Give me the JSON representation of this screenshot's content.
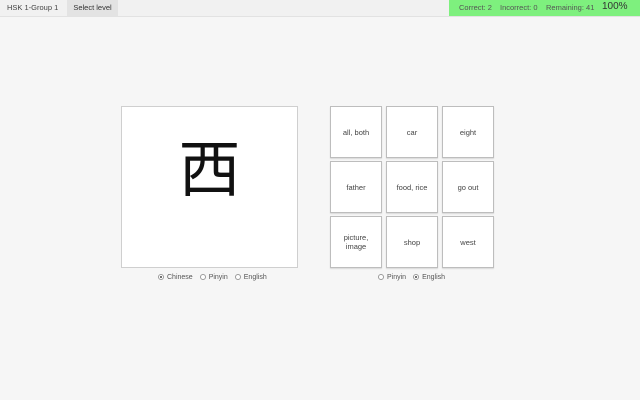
{
  "header": {
    "level_title": "HSK 1-Group 1",
    "select_level_label": "Select level",
    "correct": "Correct: 2",
    "incorrect": "Incorrect: 0",
    "remaining": "Remaining: 41",
    "percent": "100%",
    "stats_color": "#7ef07e"
  },
  "card": {
    "character": "西"
  },
  "prompt_options": [
    {
      "label": "Chinese",
      "selected": true
    },
    {
      "label": "Pinyin",
      "selected": false
    },
    {
      "label": "English",
      "selected": false
    }
  ],
  "answers": [
    "all, both",
    "car",
    "eight",
    "father",
    "food, rice",
    "go out",
    "picture, image",
    "shop",
    "west"
  ],
  "answer_options": [
    {
      "label": "Pinyin",
      "selected": false
    },
    {
      "label": "English",
      "selected": true
    }
  ]
}
